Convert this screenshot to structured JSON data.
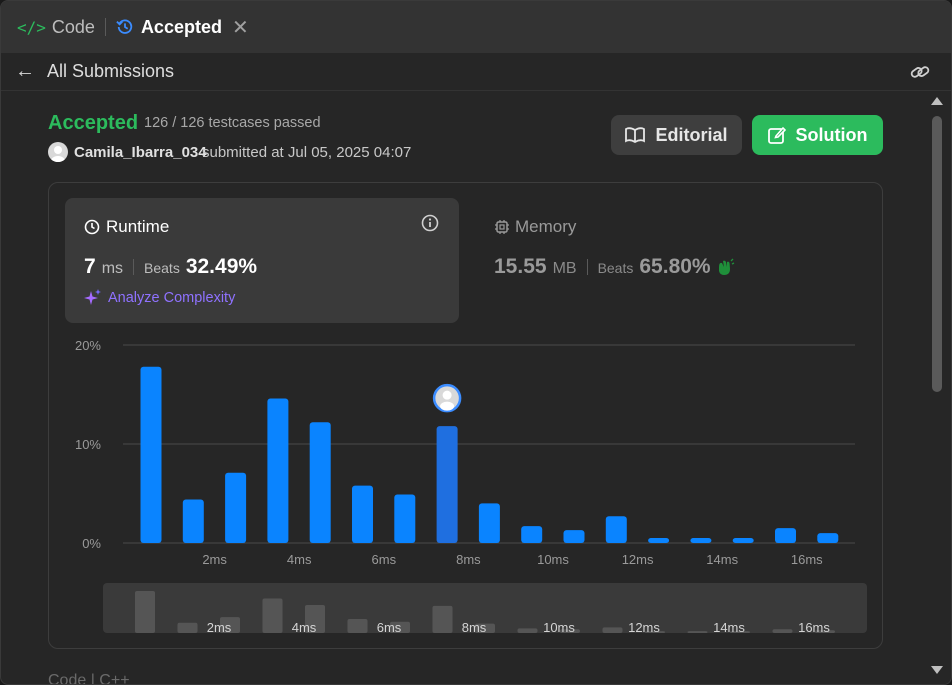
{
  "tabs": {
    "code_label": "Code",
    "code_icon": "</>",
    "accepted_label": "Accepted",
    "close_glyph": "✕"
  },
  "subbar": {
    "back_glyph": "←",
    "title": "All Submissions"
  },
  "submission": {
    "status": "Accepted",
    "testcases": "126 / 126 testcases passed",
    "user": "Camila_Ibarra_034",
    "submitted_at": "submitted at Jul 05, 2025 04:07"
  },
  "buttons": {
    "editorial": "Editorial",
    "solution": "Solution"
  },
  "runtime": {
    "title": "Runtime",
    "value": "7",
    "unit": "ms",
    "beats_label": "Beats",
    "beats_value": "32.49%",
    "analyze": "Analyze Complexity"
  },
  "memory": {
    "title": "Memory",
    "value": "15.55",
    "unit": "MB",
    "beats_label": "Beats",
    "beats_value": "65.80%"
  },
  "bottom_peek": "Code | C++",
  "colors": {
    "accent_green": "#2cbb5d",
    "bar_blue": "#0a84ff",
    "bar_highlight": "#1f6fe0",
    "analyze_purple": "#8f72ff"
  },
  "chart_data": {
    "type": "bar",
    "y_ticks": [
      "20%",
      "10%",
      "0%"
    ],
    "ylim": [
      0,
      20
    ],
    "x_tick_labels": [
      "2ms",
      "4ms",
      "6ms",
      "8ms",
      "10ms",
      "12ms",
      "14ms",
      "16ms"
    ],
    "values": [
      17.8,
      4.4,
      7.1,
      14.6,
      12.2,
      5.8,
      4.9,
      11.8,
      4.0,
      1.7,
      1.3,
      2.7,
      0.5,
      0.5,
      0.5,
      1.5,
      1.0
    ],
    "highlight_index": 7,
    "grid": true,
    "minimap_values": [
      4.5,
      1.1,
      1.7,
      3.7,
      3.0,
      1.5,
      1.2,
      2.9,
      1.0,
      0.5,
      0.4,
      0.6,
      0.2,
      0.2,
      0.2,
      0.4,
      0.3
    ]
  }
}
